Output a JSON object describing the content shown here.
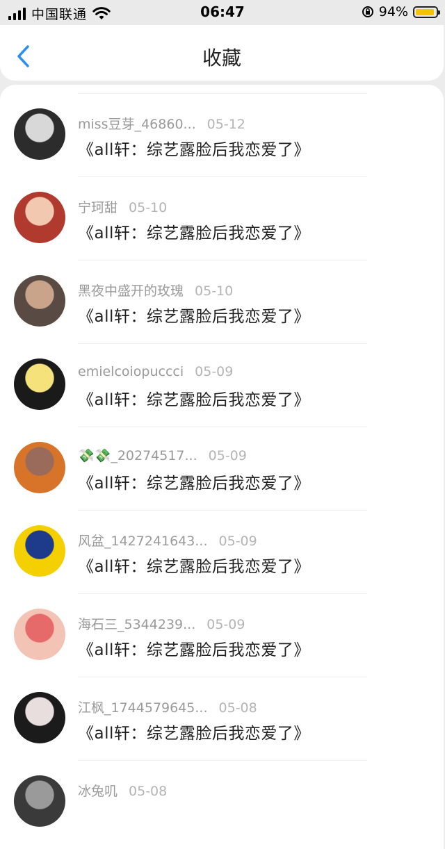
{
  "status_bar": {
    "carrier": "中国联通",
    "time": "06:47",
    "battery_percent": "94%",
    "battery_level": 0.94,
    "battery_color": "#f5c400"
  },
  "nav": {
    "back_icon": "chevron-left-icon",
    "title": "收藏",
    "accent_color": "#2b8ff0"
  },
  "items": [
    {
      "user": "miss豆芽_46860...",
      "date": "05-12",
      "title": "《all轩：综艺露脸后我恋爱了》",
      "avatar_colors": [
        "#2c2c2c",
        "#d8d8d8"
      ]
    },
    {
      "user": "宁珂甜",
      "date": "05-10",
      "title": "《all轩：综艺露脸后我恋爱了》",
      "avatar_colors": [
        "#b03a2e",
        "#f2c9b0"
      ]
    },
    {
      "user": "黑夜中盛开的玫瑰",
      "date": "05-10",
      "title": "《all轩：综艺露脸后我恋爱了》",
      "avatar_colors": [
        "#5a4a44",
        "#c9a38a"
      ]
    },
    {
      "user": "emielcoiopuccci",
      "date": "05-09",
      "title": "《all轩：综艺露脸后我恋爱了》",
      "avatar_colors": [
        "#1a1a1a",
        "#f6e27a"
      ]
    },
    {
      "user": "💸💸_20274517...",
      "date": "05-09",
      "title": "《all轩：综艺露脸后我恋爱了》",
      "avatar_colors": [
        "#d8742a",
        "#9a6a5a"
      ]
    },
    {
      "user": "风盆_1427241643...",
      "date": "05-09",
      "title": "《all轩：综艺露脸后我恋爱了》",
      "avatar_colors": [
        "#f4d000",
        "#1e3a8a"
      ]
    },
    {
      "user": "海石三_5344239...",
      "date": "05-09",
      "title": "《all轩：综艺露脸后我恋爱了》",
      "avatar_colors": [
        "#f3c3b6",
        "#e76a6a"
      ]
    },
    {
      "user": "江枫_1744579645...",
      "date": "05-08",
      "title": "《all轩：综艺露脸后我恋爱了》",
      "avatar_colors": [
        "#1b1b1b",
        "#e8dede"
      ]
    },
    {
      "user": "冰兔叽",
      "date": "05-08",
      "title": "",
      "avatar_colors": [
        "#3a3a3a",
        "#9a9a9a"
      ]
    }
  ]
}
